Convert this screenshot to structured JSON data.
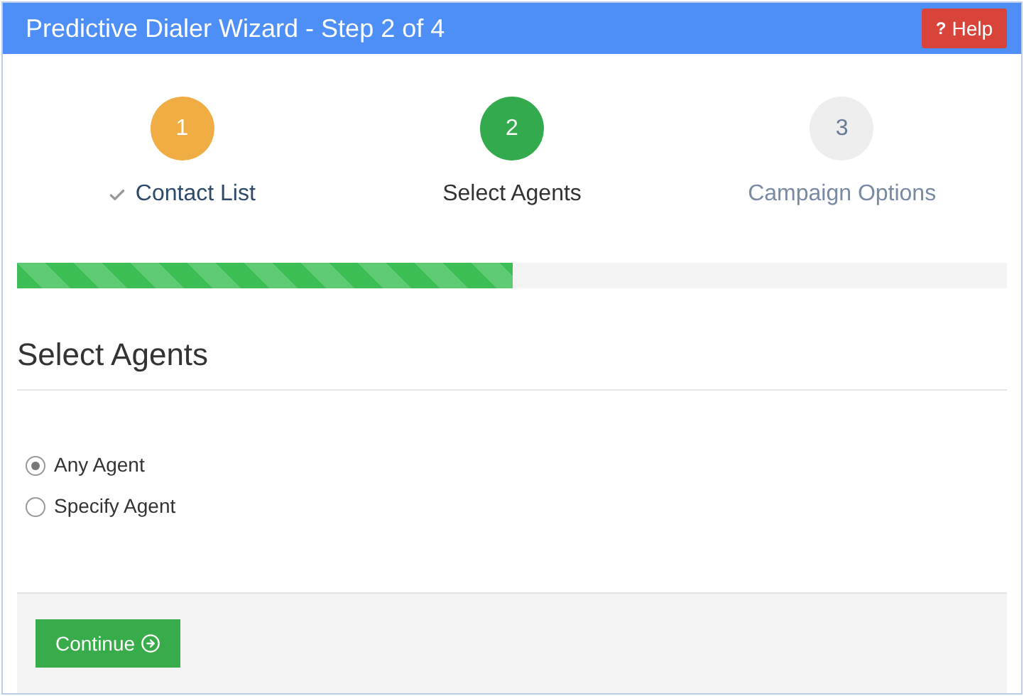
{
  "window": {
    "title": "Predictive Dialer Wizard - Step 2 of 4"
  },
  "help_button": {
    "icon": "?",
    "label": "Help"
  },
  "steps": [
    {
      "number": "1",
      "label": "Contact List",
      "kind": "done"
    },
    {
      "number": "2",
      "label": "Select Agents",
      "kind": "current"
    },
    {
      "number": "3",
      "label": "Campaign Options",
      "kind": "upcoming"
    }
  ],
  "progress": {
    "level": 0.5
  },
  "section": {
    "title": "Select Agents"
  },
  "options": [
    {
      "label": "Any Agent",
      "selected": true
    },
    {
      "label": "Specify Agent",
      "selected": false
    }
  ],
  "footer": {
    "button": "Continue"
  }
}
